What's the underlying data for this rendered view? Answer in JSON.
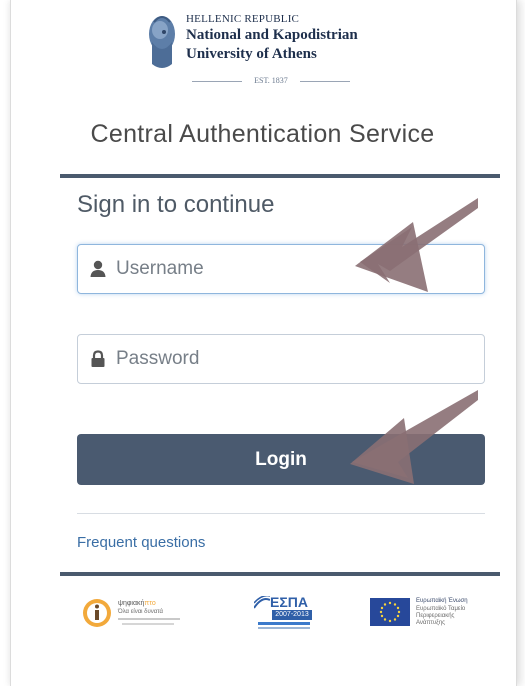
{
  "header": {
    "line1": "HELLENIC REPUBLIC",
    "line2": "National and Kapodistrian",
    "line3": "University of Athens",
    "est": "EST. 1837"
  },
  "service_title": "Central Authentication Service",
  "login": {
    "heading": "Sign in to continue",
    "username_placeholder": "Username",
    "password_placeholder": "Password",
    "login_label": "Login",
    "faq_label": "Frequent questions"
  },
  "footer": {
    "logo1_title": "ψηφιακή",
    "logo1_title2": "πτο",
    "logo1_sub": "Όλα είναι δυνατά",
    "logo2_title": "ΕΣΠΑ",
    "logo2_sub": "2007-2013",
    "logo3_line1": "Ευρωπαϊκή Ένωση",
    "logo3_line2": "Ευρωπαϊκό Ταμείο",
    "logo3_line3": "Περιφερειακής",
    "logo3_line4": "Ανάπτυξης"
  },
  "colors": {
    "panel_accent": "#4a5a6e",
    "button": "#4a5a70",
    "link": "#3a6ea5",
    "arrow": "#8a6f73"
  }
}
